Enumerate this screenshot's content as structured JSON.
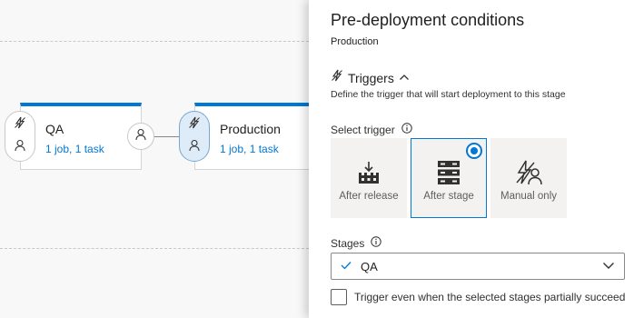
{
  "pipeline": {
    "stages": [
      {
        "name": "QA",
        "summary": "1 job, 1 task"
      },
      {
        "name": "Production",
        "summary": "1 job, 1 task"
      }
    ]
  },
  "panel": {
    "title": "Pre-deployment conditions",
    "stage": "Production",
    "triggers": {
      "title": "Triggers",
      "description": "Define the trigger that will start deployment to this stage",
      "select_label": "Select trigger",
      "options": [
        {
          "label": "After release",
          "icon": "release-icon",
          "selected": false
        },
        {
          "label": "After stage",
          "icon": "stage-icon",
          "selected": true
        },
        {
          "label": "Manual only",
          "icon": "manual-icon",
          "selected": false
        }
      ]
    },
    "stages_field": {
      "label": "Stages",
      "value": "QA"
    },
    "partial_checkbox": {
      "label": "Trigger even when the selected stages partially succeed",
      "checked": false
    }
  },
  "colors": {
    "accent": "#0078d4",
    "canvas_bg": "#f8f8f8",
    "selected_pill": "#deecf9"
  }
}
